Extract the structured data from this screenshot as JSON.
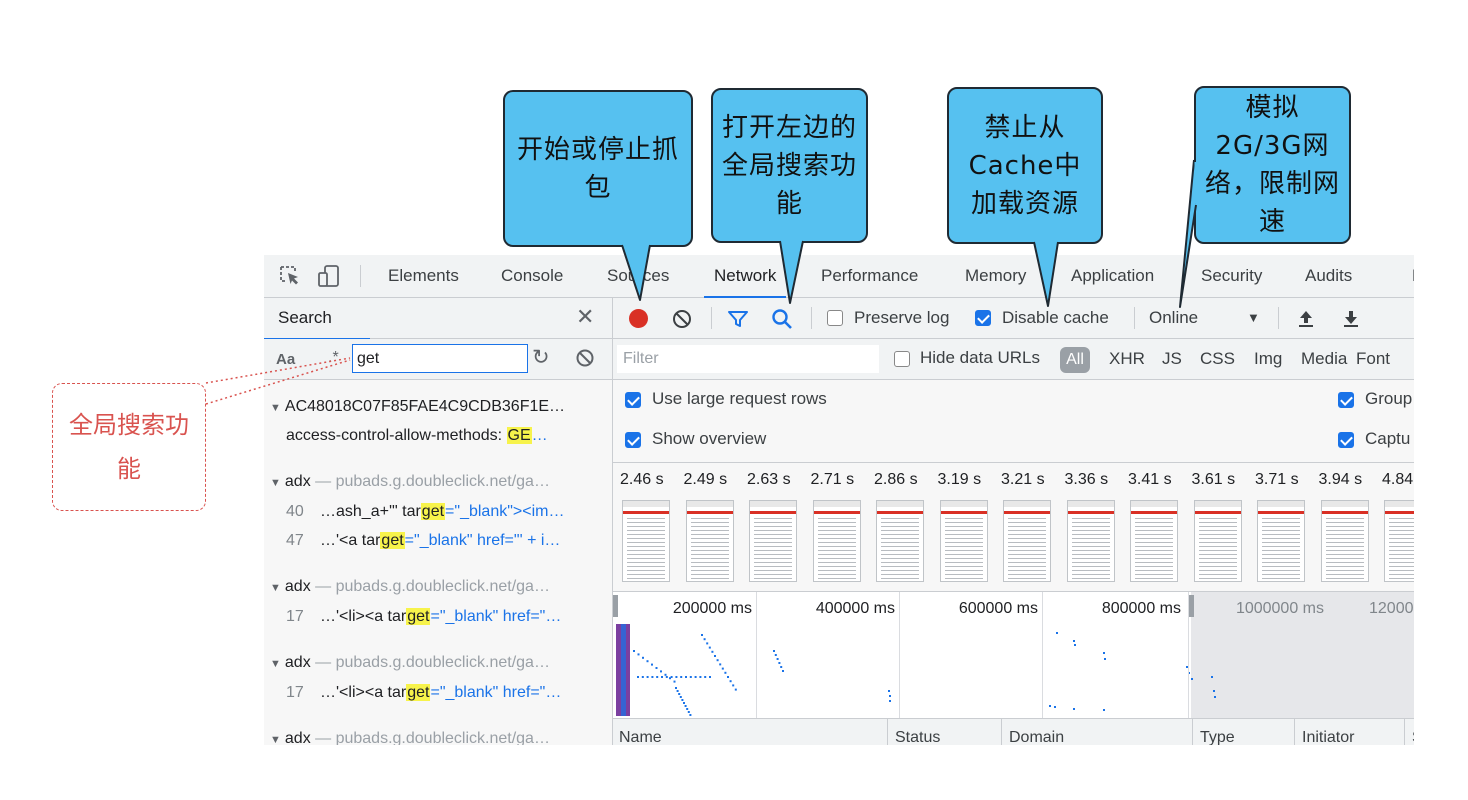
{
  "callouts": [
    {
      "id": "record",
      "text": "开始或停止抓包"
    },
    {
      "id": "search",
      "text": "打开左边的全局搜索功能"
    },
    {
      "id": "cache",
      "text": "禁止从Cache中加载资源"
    },
    {
      "id": "throttle",
      "text": "模拟2G/3G网络，限制网速"
    }
  ],
  "annotation": {
    "text": "全局搜索功能"
  },
  "tabs": [
    "Elements",
    "Console",
    "Sources",
    "Network",
    "Performance",
    "Memory",
    "Application",
    "Security",
    "Audits",
    "La"
  ],
  "active_tab": "Network",
  "search_panel": {
    "title": "Search",
    "match_case_label": "Aa",
    "regex_label": ".*",
    "query": "get",
    "results": [
      {
        "file": "AC48018C07F85FAE4C9CDB36F1E…",
        "source": "",
        "lines": [
          {
            "num": "",
            "pre": "access-control-allow-methods:  ",
            "match": "GE",
            "post": "…"
          }
        ]
      },
      {
        "file": "adx",
        "source": "— pubads.g.doubleclick.net/ga…",
        "lines": [
          {
            "num": "40",
            "pre": "…ash_a+'\" tar",
            "match": "get",
            "post": "=\"_blank\"><im…"
          },
          {
            "num": "47",
            "pre": "…'<a tar",
            "match": "get",
            "post": "=\"_blank\" href=\"' + i…"
          }
        ]
      },
      {
        "file": "adx",
        "source": "— pubads.g.doubleclick.net/ga…",
        "lines": [
          {
            "num": "17",
            "pre": "…'<li><a tar",
            "match": "get",
            "post": "=\"_blank\" href=\"…"
          }
        ]
      },
      {
        "file": "adx",
        "source": "— pubads.g.doubleclick.net/ga…",
        "lines": [
          {
            "num": "17",
            "pre": "…'<li><a tar",
            "match": "get",
            "post": "=\"_blank\" href=\"…"
          }
        ]
      },
      {
        "file": "adx",
        "source": "— pubads.g.doubleclick.net/ga…",
        "lines": []
      }
    ]
  },
  "network": {
    "preserve_log": {
      "label": "Preserve log",
      "checked": false
    },
    "disable_cache": {
      "label": "Disable cache",
      "checked": true
    },
    "throttle": "Online",
    "filter_placeholder": "Filter",
    "hide_data_urls": {
      "label": "Hide data URLs",
      "checked": false
    },
    "types": [
      "All",
      "XHR",
      "JS",
      "CSS",
      "Img",
      "Media",
      "Font"
    ],
    "options": {
      "large_rows": {
        "label": "Use large request rows",
        "checked": true
      },
      "overview": {
        "label": "Show overview",
        "checked": true
      },
      "group": {
        "label": "Group",
        "checked": true
      },
      "capture": {
        "label": "Captu",
        "checked": true
      }
    },
    "screenshot_times": [
      "2.46 s",
      "2.49 s",
      "2.63 s",
      "2.71 s",
      "2.86 s",
      "3.19 s",
      "3.21 s",
      "3.36 s",
      "3.41 s",
      "3.61 s",
      "3.71 s",
      "3.94 s",
      "4.84"
    ],
    "overview_labels": [
      "200000 ms",
      "400000 ms",
      "600000 ms",
      "800000 ms",
      "1000000 ms",
      "12000"
    ],
    "columns": [
      "Name",
      "Status",
      "Domain",
      "Type",
      "Initiator",
      "S"
    ]
  },
  "colors": {
    "accent": "#1a73e8",
    "record": "#d93025",
    "callout": "#56c1f0",
    "annotation": "#d9534f",
    "highlight": "#f7f34b"
  }
}
